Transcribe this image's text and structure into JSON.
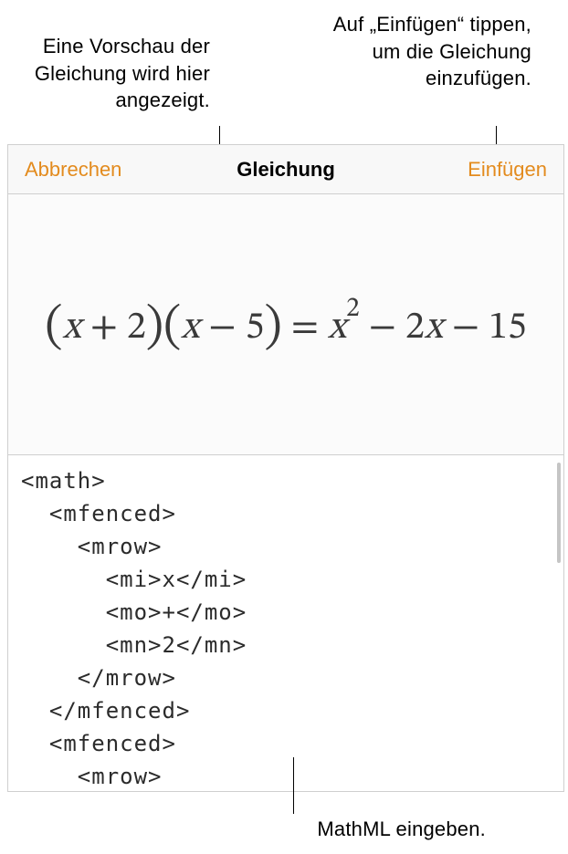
{
  "callouts": {
    "preview": "Eine Vorschau der Gleichung wird hier angezeigt.",
    "insert": "Auf „Einfügen“ tippen, um die Gleichung einzufügen.",
    "mathml": "MathML eingeben."
  },
  "toolbar": {
    "cancel_label": "Abbrechen",
    "title": "Gleichung",
    "insert_label": "Einfügen"
  },
  "equation": {
    "lhs_a_var": "x",
    "lhs_a_op": "+",
    "lhs_a_num": "2",
    "lhs_b_var": "x",
    "lhs_b_op": "−",
    "lhs_b_num": "5",
    "eq": "=",
    "rhs_t1_base": "x",
    "rhs_t1_exp": "2",
    "rhs_op1": "−",
    "rhs_t2_coef": "2",
    "rhs_t2_var": "x",
    "rhs_op2": "−",
    "rhs_t3": "15"
  },
  "code": {
    "l1": "<math>",
    "l2": "  <mfenced>",
    "l3": "    <mrow>",
    "l4": "      <mi>x</mi>",
    "l5": "      <mo>+</mo>",
    "l6": "      <mn>2</mn>",
    "l7": "    </mrow>",
    "l8": "  </mfenced>",
    "l9": "  <mfenced>",
    "l10": "    <mrow>"
  }
}
